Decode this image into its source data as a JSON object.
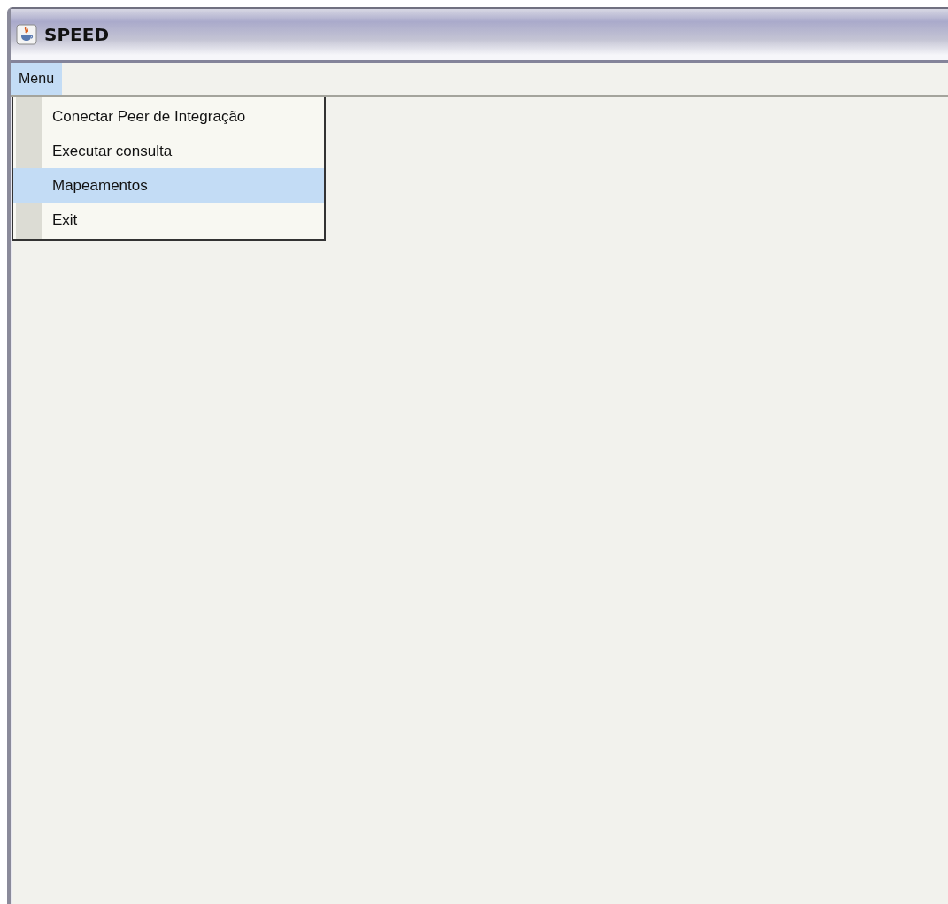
{
  "window": {
    "title": "SPEED"
  },
  "menu_bar": [
    {
      "label": "Menu",
      "selected": true
    }
  ],
  "menu_items": [
    {
      "label": "Conectar Peer de Integração",
      "selected": false
    },
    {
      "label": "Executar consulta",
      "selected": false
    },
    {
      "label": "Mapeamentos",
      "selected": true
    },
    {
      "label": "Exit",
      "selected": false
    }
  ]
}
